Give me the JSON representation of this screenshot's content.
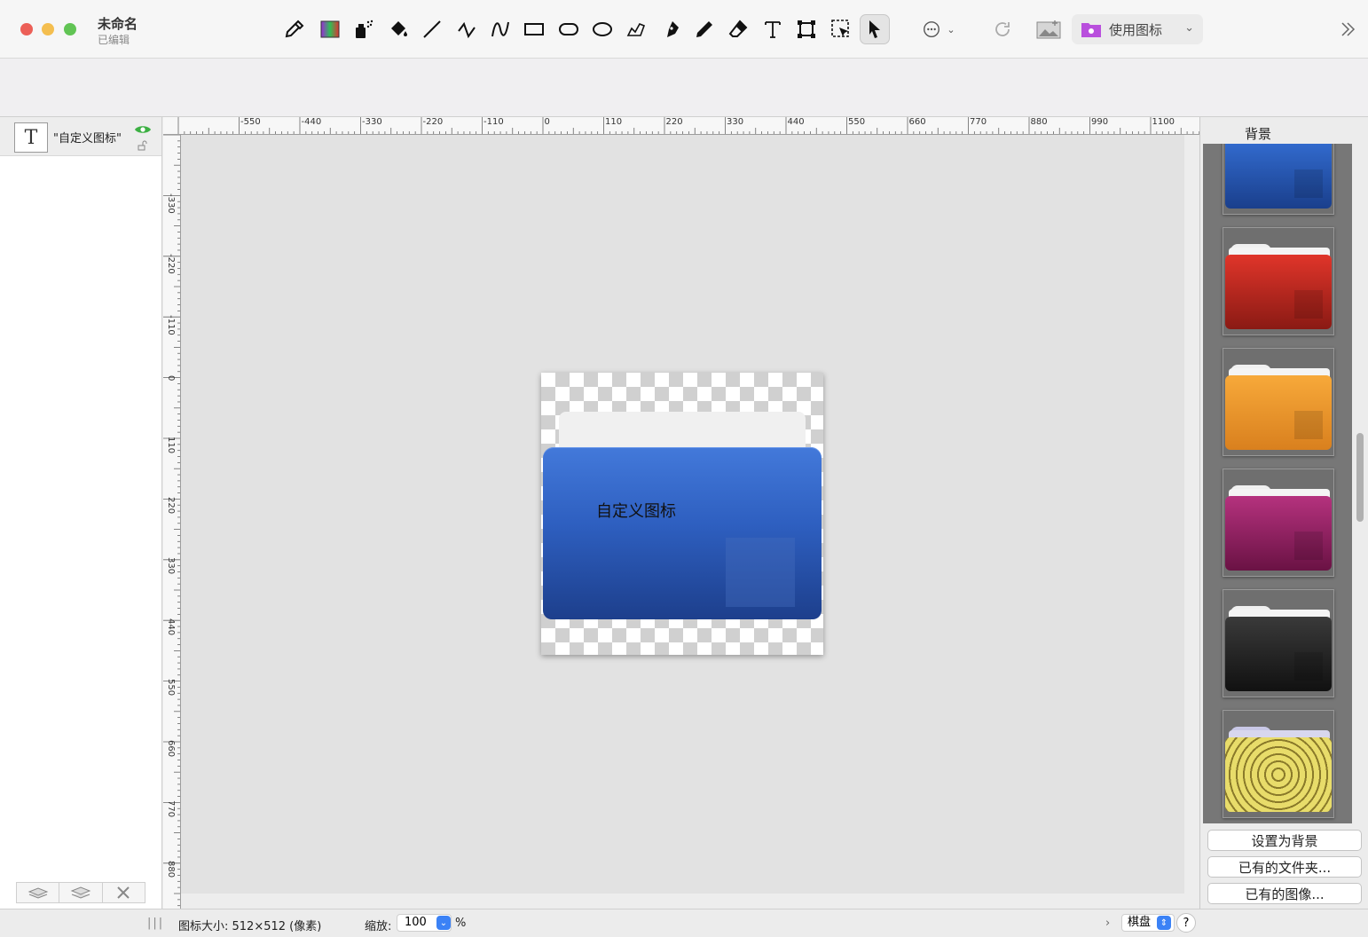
{
  "window": {
    "title": "未命名",
    "subtitle": "已编辑",
    "colors": {
      "close": "#ec5f57",
      "minimize": "#f4be4f",
      "zoom": "#61c454"
    }
  },
  "toolbar": {
    "tools": [
      {
        "name": "eyedropper-icon"
      },
      {
        "name": "gradient-icon"
      },
      {
        "name": "spray-icon"
      },
      {
        "name": "paint-bucket-icon"
      },
      {
        "name": "line-icon"
      },
      {
        "name": "polyline-icon"
      },
      {
        "name": "curve-icon"
      },
      {
        "name": "rectangle-icon"
      },
      {
        "name": "rounded-rectangle-icon"
      },
      {
        "name": "ellipse-icon"
      },
      {
        "name": "freeform-shape-icon"
      },
      {
        "name": "pen-icon"
      },
      {
        "name": "pencil-icon"
      },
      {
        "name": "eraser-icon"
      },
      {
        "name": "text-icon"
      },
      {
        "name": "transform-icon"
      },
      {
        "name": "selection-icon"
      },
      {
        "name": "arrow-pointer-icon",
        "active": true
      }
    ],
    "use_icon_label": "使用图标"
  },
  "layers": {
    "items": [
      {
        "name": "\"自定义图标\"",
        "visible": true,
        "locked": false
      }
    ]
  },
  "rulers": {
    "x_labels": [
      "-550",
      "-440",
      "-330",
      "-220",
      "-110",
      "0",
      "110",
      "220",
      "330",
      "440",
      "550",
      "660",
      "770",
      "880",
      "990",
      "1100"
    ],
    "y_labels": [
      "-330",
      "-220",
      "-110",
      "0",
      "110",
      "220",
      "330",
      "440",
      "550",
      "660",
      "770",
      "880"
    ]
  },
  "canvas": {
    "icon_text": "自定义图标",
    "folder_color": "#2e5fc0"
  },
  "background_panel": {
    "title": "背景",
    "items": [
      {
        "name": "blue",
        "top": "#3570d6",
        "bottom": "#1a3f8c"
      },
      {
        "name": "red",
        "top": "#e0352a",
        "bottom": "#8a1a14"
      },
      {
        "name": "orange",
        "top": "#f7a93a",
        "bottom": "#d9801e"
      },
      {
        "name": "magenta",
        "top": "#b5327e",
        "bottom": "#6a1244"
      },
      {
        "name": "black",
        "top": "#3a3a3a",
        "bottom": "#111111"
      },
      {
        "name": "damask",
        "top": "#e8dc6a",
        "bottom": "#c7b845"
      }
    ],
    "buttons": {
      "set_background": "设置为背景",
      "existing_folder": "已有的文件夹...",
      "existing_image": "已有的图像..."
    }
  },
  "status": {
    "icon_size": "图标大小: 512×512 (像素)",
    "zoom_label": "缩放:",
    "zoom_value": "100",
    "zoom_unit": "%",
    "background_mode": "棋盘",
    "help": "?"
  }
}
